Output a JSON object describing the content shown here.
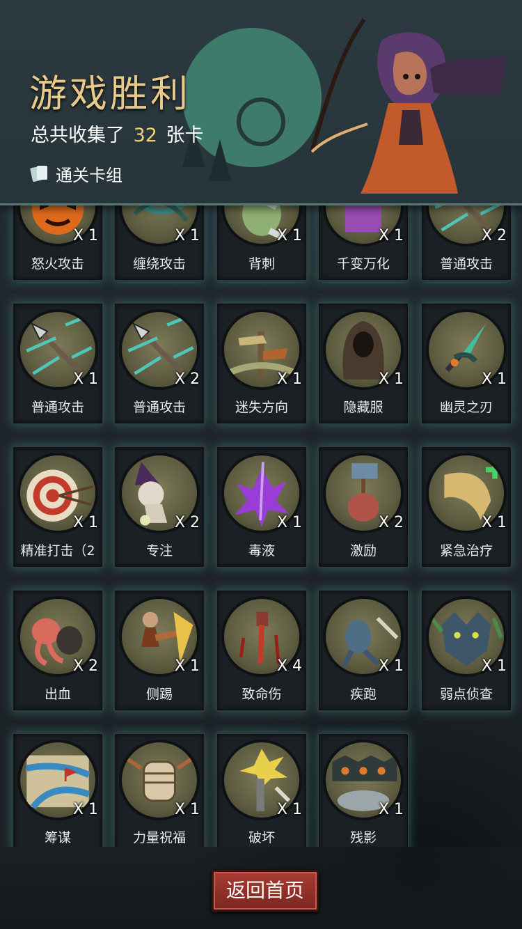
{
  "header": {
    "title": "游戏胜利",
    "collected_prefix": "总共收集了",
    "collected_count": "32",
    "collected_suffix": "张卡",
    "deck_label": "通关卡组"
  },
  "cards": [
    {
      "name": "怒火攻击",
      "count": "X 1",
      "icon": "flaming-pumpkin-icon"
    },
    {
      "name": "缠绕攻击",
      "count": "X 1",
      "icon": "vine-strike-icon"
    },
    {
      "name": "背刺",
      "count": "X 1",
      "icon": "backstab-icon"
    },
    {
      "name": "千变万化",
      "count": "X 1",
      "icon": "shapeshift-box-icon"
    },
    {
      "name": "普通攻击",
      "count": "X 2",
      "icon": "arrow-strike-icon"
    },
    {
      "name": "普通攻击",
      "count": "X 1",
      "icon": "arrow-strike-icon"
    },
    {
      "name": "普通攻击",
      "count": "X 2",
      "icon": "arrow-strike-icon"
    },
    {
      "name": "迷失方向",
      "count": "X 1",
      "icon": "signpost-icon"
    },
    {
      "name": "隐藏服",
      "count": "X 1",
      "icon": "hooded-cloak-icon"
    },
    {
      "name": "幽灵之刃",
      "count": "X 1",
      "icon": "ghost-blade-icon"
    },
    {
      "name": "精准打击（2",
      "count": "X 1",
      "icon": "bullseye-icon"
    },
    {
      "name": "专注",
      "count": "X 2",
      "icon": "wizard-icon"
    },
    {
      "name": "毒液",
      "count": "X 1",
      "icon": "venom-splash-icon"
    },
    {
      "name": "激励",
      "count": "X 2",
      "icon": "hammer-brute-icon"
    },
    {
      "name": "紧急治疗",
      "count": "X 1",
      "icon": "healing-scroll-icon"
    },
    {
      "name": "出血",
      "count": "X 2",
      "icon": "octopus-icon"
    },
    {
      "name": "侧踢",
      "count": "X 1",
      "icon": "kick-fighter-icon"
    },
    {
      "name": "致命伤",
      "count": "X 4",
      "icon": "bloody-blade-icon"
    },
    {
      "name": "疾跑",
      "count": "X 1",
      "icon": "sprinting-beast-icon"
    },
    {
      "name": "弱点侦查",
      "count": "X 1",
      "icon": "wolf-head-icon"
    },
    {
      "name": "筹谋",
      "count": "X 1",
      "icon": "battle-map-icon"
    },
    {
      "name": "力量祝福",
      "count": "X 1",
      "icon": "fist-icon"
    },
    {
      "name": "破坏",
      "count": "X 1",
      "icon": "broken-torch-icon"
    },
    {
      "name": "残影",
      "count": "X 1",
      "icon": "shadow-clones-icon"
    }
  ],
  "footer": {
    "home_button": "返回首页"
  },
  "colors": {
    "title": "#e8c98a",
    "count_highlight": "#f0d36a",
    "button": "#a93d33",
    "card_glow": "#468c82"
  }
}
